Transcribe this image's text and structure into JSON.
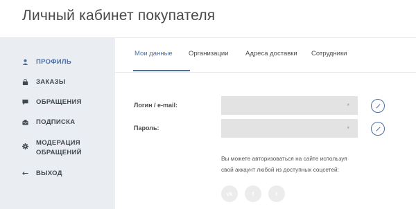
{
  "header": {
    "title": "Личный кабинет покупателя"
  },
  "sidebar": {
    "items": [
      {
        "label": "ПРОФИЛЬ",
        "icon": "user-icon",
        "active": true
      },
      {
        "label": "ЗАКАЗЫ",
        "icon": "bag-icon",
        "active": false
      },
      {
        "label": "ОБРАЩЕНИЯ",
        "icon": "chat-icon",
        "active": false
      },
      {
        "label": "ПОДПИСКА",
        "icon": "envelope-icon",
        "active": false
      },
      {
        "label": "МОДЕРАЦИЯ\nОБРАЩЕНИЙ",
        "icon": "gear-icon",
        "active": false
      },
      {
        "label": "ВЫХОД",
        "icon": "arrow-left-icon",
        "active": false
      }
    ]
  },
  "tabs": [
    {
      "label": "Мои данные",
      "active": true
    },
    {
      "label": "Организации",
      "active": false
    },
    {
      "label": "Адреса доставки",
      "active": false
    },
    {
      "label": "Сотрудники",
      "active": false
    }
  ],
  "form": {
    "login_label": "Логин / e-mail:",
    "login_marker": "*",
    "password_label": "Пароль:",
    "password_marker": "*"
  },
  "social": {
    "note_line1": "Вы можете авторизоваться на сайте используя",
    "note_line2": "свой аккаунт любой из доступных соцсетей:",
    "buttons": [
      {
        "label": "vk",
        "icon": "vk-icon"
      },
      {
        "label": "f",
        "icon": "facebook-icon"
      },
      {
        "label": "t",
        "icon": "twitter-icon"
      }
    ]
  },
  "colors": {
    "accent": "#4a6fa5",
    "sidebar_bg": "#eaeef2",
    "field_bg": "#e3e3e3"
  }
}
